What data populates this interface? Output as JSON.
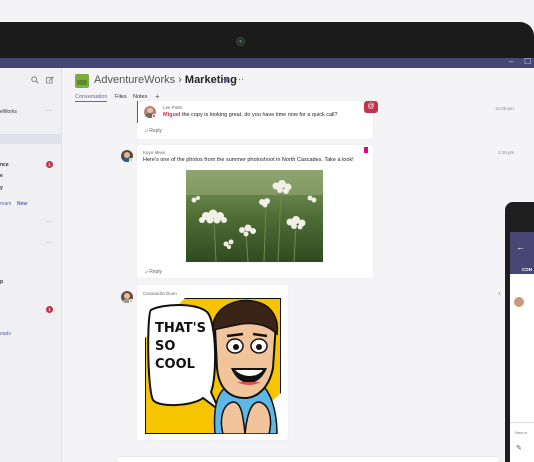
{
  "titlebar": {
    "minimize": "–",
    "restore": "☐"
  },
  "sidebar": {
    "search_icon": "search-icon",
    "compose_icon": "compose-icon",
    "team_name_fragment": "eWorks",
    "items": [
      {
        "label": "nce",
        "bold": true,
        "badge": "1"
      },
      {
        "label": "e",
        "bold": true
      },
      {
        "label": "y",
        "bold": true
      },
      {
        "label": "ream",
        "link": true,
        "tag": "New"
      },
      {
        "label": "p",
        "bold": true
      },
      {
        "label": "eads",
        "link": true
      }
    ],
    "badge_low": "1"
  },
  "channel": {
    "team": "AdventureWorks",
    "separator": "›",
    "name": "Marketing",
    "star": "★",
    "more": "···"
  },
  "tabs": [
    {
      "label": "Conversation",
      "active": true
    },
    {
      "label": "Files"
    },
    {
      "label": "Notes"
    },
    {
      "label": "+"
    }
  ],
  "messages": [
    {
      "author": "Lee Potts",
      "mention": "Miguel",
      "text": " the copy is looking great, do you have time now for a quick call?",
      "time": "12:00 pm",
      "reply": "Reply"
    },
    {
      "author": "Kayo Miwa",
      "text": "Here's one of the photos from the summer photoshoot in North Cascades. Take a look!",
      "time": "1:15 pm",
      "reply": "Reply"
    },
    {
      "author": "Cassandra Dunn",
      "sticker_text": [
        "THAT'S",
        "SO",
        "COOL"
      ],
      "time": "1:"
    }
  ],
  "phone": {
    "back": "←",
    "tab": "CON",
    "input_placeholder": "New m",
    "pen": "✎"
  },
  "colors": {
    "accent": "#6264a7",
    "titlebar": "#464775",
    "mention": "#c4314b",
    "bookmark": "#e3008c"
  }
}
